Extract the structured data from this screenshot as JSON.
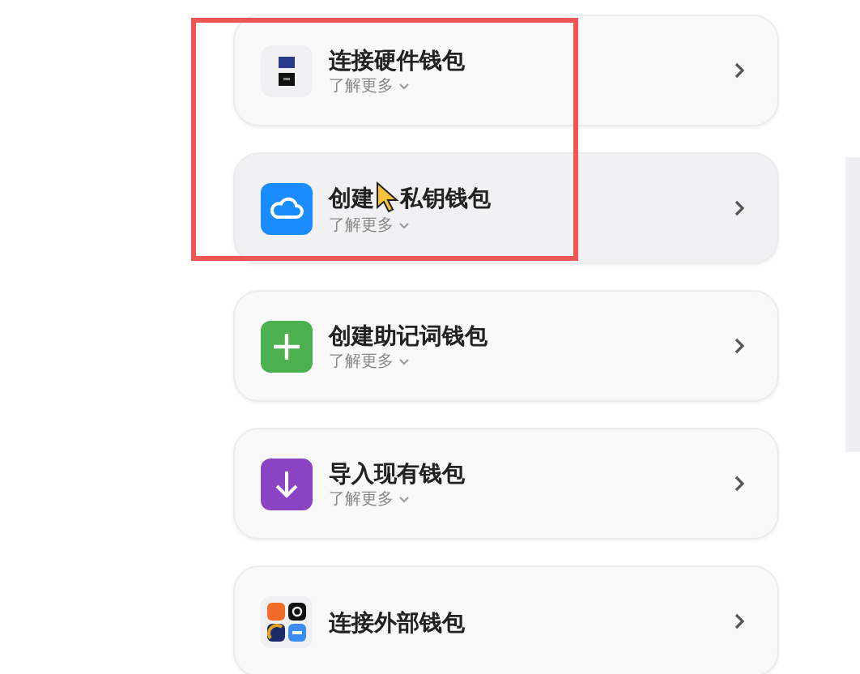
{
  "options": [
    {
      "kind": "hardware",
      "title": "连接硬件钱包",
      "more": "了解更多"
    },
    {
      "kind": "cloud",
      "title": "创建",
      "title_after_cursor": "私钥钱包",
      "more": "了解更多"
    },
    {
      "kind": "plus",
      "title": "创建助记词钱包",
      "more": "了解更多"
    },
    {
      "kind": "import",
      "title": "导入现有钱包",
      "more": "了解更多"
    },
    {
      "kind": "external",
      "title": "连接外部钱包"
    }
  ]
}
